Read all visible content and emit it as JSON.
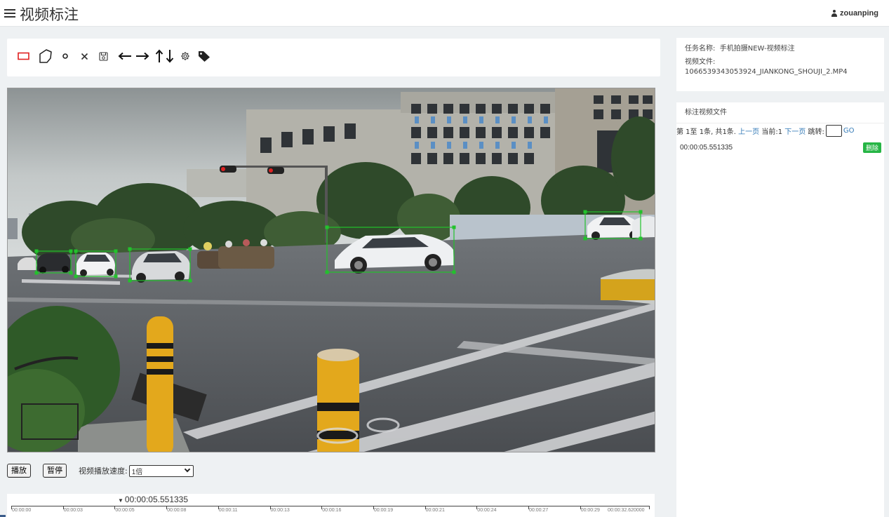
{
  "app": {
    "title": "视频标注",
    "user": "zouanping"
  },
  "toolbar": {
    "tools": [
      {
        "name": "rectangle",
        "icon": "rectangle-icon"
      },
      {
        "name": "polygon",
        "icon": "polygon-icon"
      },
      {
        "name": "point",
        "icon": "point-icon"
      },
      {
        "name": "delete",
        "icon": "close-icon"
      },
      {
        "name": "save",
        "icon": "save-icon"
      },
      {
        "name": "move-left",
        "icon": "arrow-left-icon"
      },
      {
        "name": "move-right",
        "icon": "arrow-right-icon"
      },
      {
        "name": "move-up",
        "icon": "arrow-up-icon"
      },
      {
        "name": "move-down",
        "icon": "arrow-down-icon"
      },
      {
        "name": "settings",
        "icon": "gear-icon"
      },
      {
        "name": "tag",
        "icon": "tag-icon"
      }
    ],
    "active_color": "#e02020"
  },
  "video": {
    "box_color": "#22c22c",
    "annotation_count": 6
  },
  "controls": {
    "play_label": "播放",
    "pause_label": "暂停",
    "speed_label": "视频播放速度:",
    "speed_value": "1倍"
  },
  "timeline": {
    "cursor_time": "00:00:05.551335",
    "ticks": [
      "00:00:00",
      "00:00:03",
      "00:00:05",
      "00:00:08",
      "00:00:11",
      "00:00:13",
      "00:00:16",
      "00:00:19",
      "00:00:21",
      "00:00:24",
      "00:00:27",
      "00:00:29"
    ],
    "end_label": "00:00:32.620000"
  },
  "info": {
    "task_label": "任务名称:",
    "task_name": "手机拍摄NEW-视频标注",
    "file_label": "视频文件:",
    "file_name": "1066539343053924_JIANKONG_SHOUJI_2.MP4"
  },
  "files": {
    "title": "标注视频文件",
    "pager_summary": "第 1至 1条, 共1条.",
    "prev": "上一页",
    "current": "当前:1",
    "next": "下一页",
    "jump": "跳转:",
    "go": "GO",
    "items": [
      {
        "time": "00:00:05.551335",
        "delete_label": "删除"
      }
    ],
    "delete_color": "#26b545",
    "link_color": "#337ab7"
  }
}
